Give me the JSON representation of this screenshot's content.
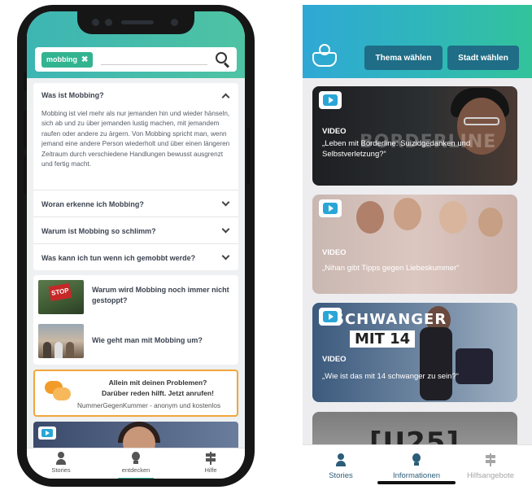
{
  "left_app": {
    "search": {
      "chip_label": "mobbing",
      "chip_close": "✖"
    },
    "faq": {
      "open_question": "Was ist Mobbing?",
      "answer": "Mobbing ist viel mehr als nur jemanden hin und wieder hänseln, sich ab und zu über jemanden lustig machen, mit jemandem raufen oder andere zu ärgern. Von Mobbing spricht man, wenn jemand eine andere Person wiederholt und über einen längeren Zeitraum durch verschiedene Handlungen bewusst ausgrenzt und fertig macht.",
      "questions": [
        "Woran erkenne ich Mobbing?",
        "Warum ist Mobbing so schlimm?",
        "Was kann ich tun wenn ich gemobbt werde?"
      ]
    },
    "related": [
      {
        "title": "Warum wird Mobbing noch immer nicht gestoppt?",
        "thumb_text": "STOP"
      },
      {
        "title": "Wie geht man mit Mobbing um?"
      }
    ],
    "help": {
      "line1": "Allein mit deinen Problemen?",
      "line2": "Darüber reden hilft. Jetzt anrufen!",
      "line3": "NummerGegenKummer - anonym und kostenlos"
    },
    "tabs": [
      {
        "label": "Stories",
        "icon": "person-icon"
      },
      {
        "label": "entdecken",
        "icon": "bulb-icon",
        "active": true
      },
      {
        "label": "Hilfe",
        "icon": "signpost-icon"
      }
    ]
  },
  "right_app": {
    "header": {
      "btn_thema": "Thema wählen",
      "btn_stadt": "Stadt wählen",
      "logo_icon": "book-person-icon"
    },
    "videos": [
      {
        "kicker": "VIDEO",
        "title": "„Leben mit Borderline: Suizidgedanken und Selbstverletzung?“",
        "overlay": "BORDERLINE"
      },
      {
        "kicker": "VIDEO",
        "title": "„Nihan gibt Tipps gegen Liebeskummer“"
      },
      {
        "kicker": "VIDEO",
        "title": "„Wie ist das mit 14 schwanger zu sein?“",
        "overlay1": "SCHWANGER",
        "overlay2": "MIT 14"
      },
      {
        "overlay": "[U25]"
      }
    ],
    "tabs": [
      {
        "label": "Stories",
        "icon": "person-icon"
      },
      {
        "label": "Informationen",
        "icon": "bulb-icon",
        "active": true
      },
      {
        "label": "Hilfsangebote",
        "icon": "signpost-icon",
        "disabled": true
      }
    ]
  },
  "colors": {
    "teal": "#3db5b3",
    "green": "#33b491",
    "orange": "#f1a63c",
    "header_btn": "#1f6d86"
  }
}
